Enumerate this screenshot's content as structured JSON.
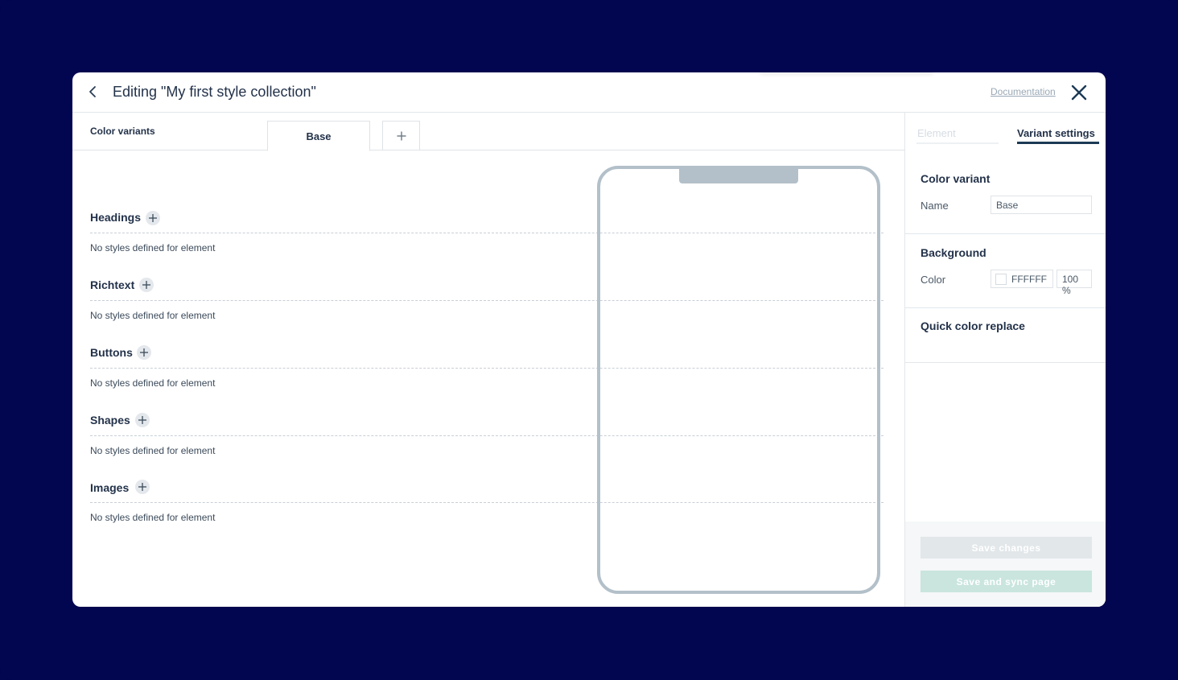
{
  "header": {
    "title": "Editing \"My first style collection\"",
    "documentation_link": "Documentation"
  },
  "variants": {
    "label": "Color variants",
    "tabs": [
      {
        "label": "Base",
        "active": true
      }
    ]
  },
  "sections": [
    {
      "title": "Headings",
      "empty_text": "No styles defined for element"
    },
    {
      "title": "Richtext",
      "empty_text": "No styles defined for element"
    },
    {
      "title": "Buttons",
      "empty_text": "No styles defined for element"
    },
    {
      "title": "Shapes",
      "empty_text": "No styles defined for element"
    },
    {
      "title": "Images",
      "empty_text": "No styles defined for element"
    }
  ],
  "right_panel": {
    "tabs": [
      {
        "label": "Element",
        "active": false
      },
      {
        "label": "Variant settings",
        "active": true
      }
    ],
    "color_variant": {
      "title": "Color variant",
      "name_label": "Name",
      "name_value": "Base"
    },
    "background": {
      "title": "Background",
      "color_label": "Color",
      "color_value": "FFFFFF",
      "opacity_value": "100 %"
    },
    "quick_replace": {
      "title": "Quick color replace"
    },
    "buttons": {
      "save": "Save changes",
      "save_sync": "Save and sync page"
    }
  },
  "colors": {
    "page_background": "#02054f",
    "accent": "#1c3a55",
    "phone_frame": "#b3c0c9",
    "sync_button": "#c9e5de"
  }
}
